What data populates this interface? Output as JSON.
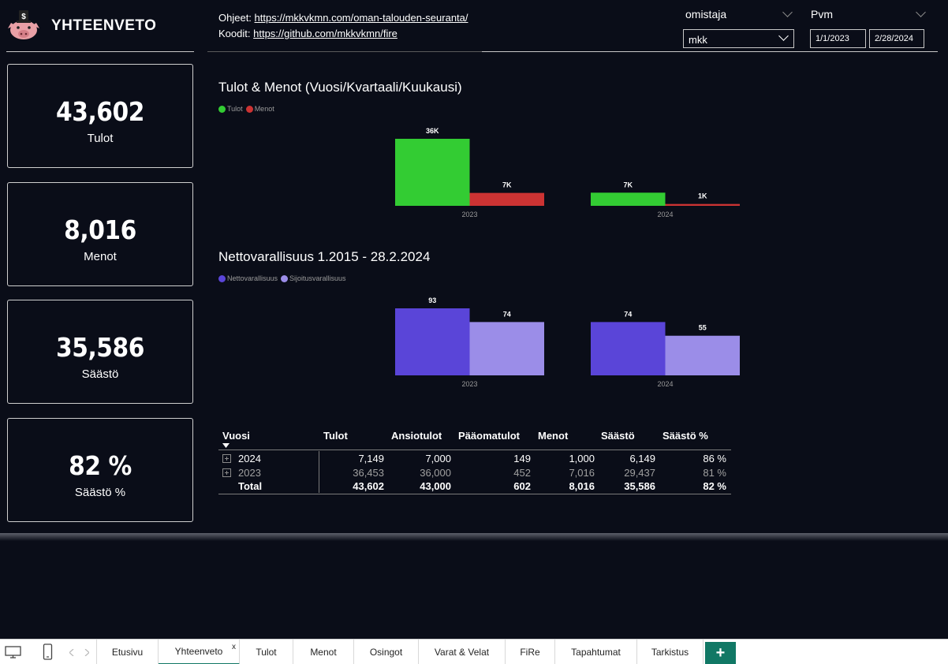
{
  "header": {
    "title": "YHTEENVETO",
    "help_label": "Ohjeet:",
    "help_url": "https://mkkvkmn.com/oman-talouden-seuranta/",
    "code_label": "Koodit:",
    "code_url": "https://github.com/mkkvkmn/fire"
  },
  "filters": {
    "owner_label": "omistaja",
    "owner_value": "mkk",
    "date_label": "Pvm",
    "date_start": "1/1/2023",
    "date_end": "2/28/2024"
  },
  "cards": [
    {
      "value": "43,602",
      "label": "Tulot"
    },
    {
      "value": "8,016",
      "label": "Menot"
    },
    {
      "value": "35,586",
      "label": "Säästö"
    },
    {
      "value": "82 %",
      "label": "Säästö %"
    }
  ],
  "colors": {
    "tulot": "#33cc33",
    "menot": "#cc3333",
    "nettovarallisuus": "#5a45d8",
    "sijoitusvarallisuus": "#9b8de8",
    "tab_accent": "#117865"
  },
  "chart_data": [
    {
      "type": "bar",
      "title": "Tulot & Menot (Vuosi/Kvartaali/Kuukausi)",
      "categories": [
        "2023",
        "2024"
      ],
      "series": [
        {
          "name": "Tulot",
          "values": [
            36453,
            7149
          ],
          "labels": [
            "36K",
            "7K"
          ]
        },
        {
          "name": "Menot",
          "values": [
            7016,
            1000
          ],
          "labels": [
            "7K",
            "1K"
          ]
        }
      ],
      "ylim": [
        0,
        36453
      ]
    },
    {
      "type": "bar",
      "title": "Nettovarallisuus 1.2015 - 28.2.2024",
      "categories": [
        "2023",
        "2024"
      ],
      "series": [
        {
          "name": "Nettovarallisuus",
          "values": [
            93,
            74
          ],
          "labels": [
            "93",
            "74"
          ]
        },
        {
          "name": "Sijoitusvarallisuus",
          "values": [
            74,
            55
          ],
          "labels": [
            "74",
            "55"
          ]
        }
      ],
      "ylim": [
        0,
        93
      ]
    }
  ],
  "table": {
    "headers": [
      "Vuosi",
      "Tulot",
      "Ansiotulot",
      "Pääomatulot",
      "Menot",
      "Säästö",
      "Säästö %"
    ],
    "rows": [
      [
        "2024",
        "7,149",
        "7,000",
        "149",
        "1,000",
        "6,149",
        "86 %"
      ],
      [
        "2023",
        "36,453",
        "36,000",
        "452",
        "7,016",
        "29,437",
        "81 %"
      ]
    ],
    "total": [
      "Total",
      "43,602",
      "43,000",
      "602",
      "8,016",
      "35,586",
      "82 %"
    ]
  },
  "tabs": [
    "Etusivu",
    "Yhteenveto",
    "Tulot",
    "Menot",
    "Osingot",
    "Varat & Velat",
    "FiRe",
    "Tapahtumat",
    "Tarkistus"
  ],
  "active_tab": "Yhteenveto",
  "close_glyph": "x",
  "add_glyph": "+"
}
